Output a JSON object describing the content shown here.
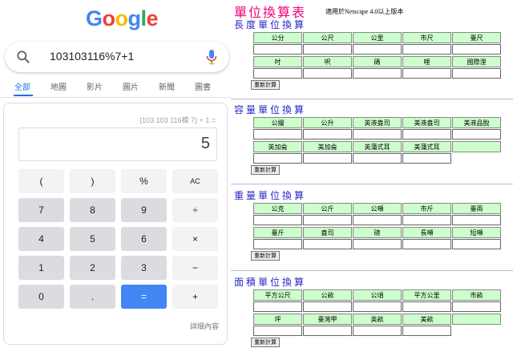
{
  "google": {
    "logo": [
      "G",
      "o",
      "o",
      "g",
      "l",
      "e"
    ],
    "logo_colors": [
      "#4285f4",
      "#ea4335",
      "#fbbc05",
      "#4285f4",
      "#34a853",
      "#ea4335"
    ],
    "query": "103103116%7+1",
    "tabs": [
      "全部",
      "地圖",
      "影片",
      "圖片",
      "新聞",
      "圖書"
    ],
    "active_tab": "全部"
  },
  "calculator": {
    "expression": "(103 103 116模 7) + 1 =",
    "result": "5",
    "keys": [
      [
        "(",
        ")",
        "%",
        "AC"
      ],
      [
        "7",
        "8",
        "9",
        "÷"
      ],
      [
        "4",
        "5",
        "6",
        "×"
      ],
      [
        "1",
        "2",
        "3",
        "−"
      ],
      [
        "0",
        ".",
        "=",
        "+"
      ]
    ],
    "more_label": "詳細內容"
  },
  "converter": {
    "title": "單位換算表",
    "note": "適用於Netscape 4.0以上版本",
    "reset_label": "重新計算",
    "sections": [
      {
        "title": "長度單位換算",
        "rows": [
          [
            "公分",
            "公尺",
            "公里",
            "市尺",
            "臺尺"
          ],
          [
            "吋",
            "呎",
            "碼",
            "哩",
            "國際浬"
          ]
        ]
      },
      {
        "title": "容量單位換算",
        "rows": [
          [
            "公撮",
            "公升",
            "英液盎司",
            "美液盎司",
            "美液品脫"
          ],
          [
            "英加侖",
            "美加侖",
            "英蒲式耳",
            "美蒲式耳",
            ""
          ]
        ]
      },
      {
        "title": "重量單位換算",
        "rows": [
          [
            "公克",
            "公斤",
            "公噸",
            "市斤",
            "臺兩"
          ],
          [
            "臺斤",
            "盎司",
            "磅",
            "長噸",
            "短噸"
          ]
        ]
      },
      {
        "title": "面積單位換算",
        "rows": [
          [
            "平方公尺",
            "公畝",
            "公頃",
            "平方公里",
            "市畝"
          ],
          [
            "坪",
            "臺灣甲",
            "英畝",
            "美畝",
            ""
          ]
        ]
      }
    ]
  }
}
